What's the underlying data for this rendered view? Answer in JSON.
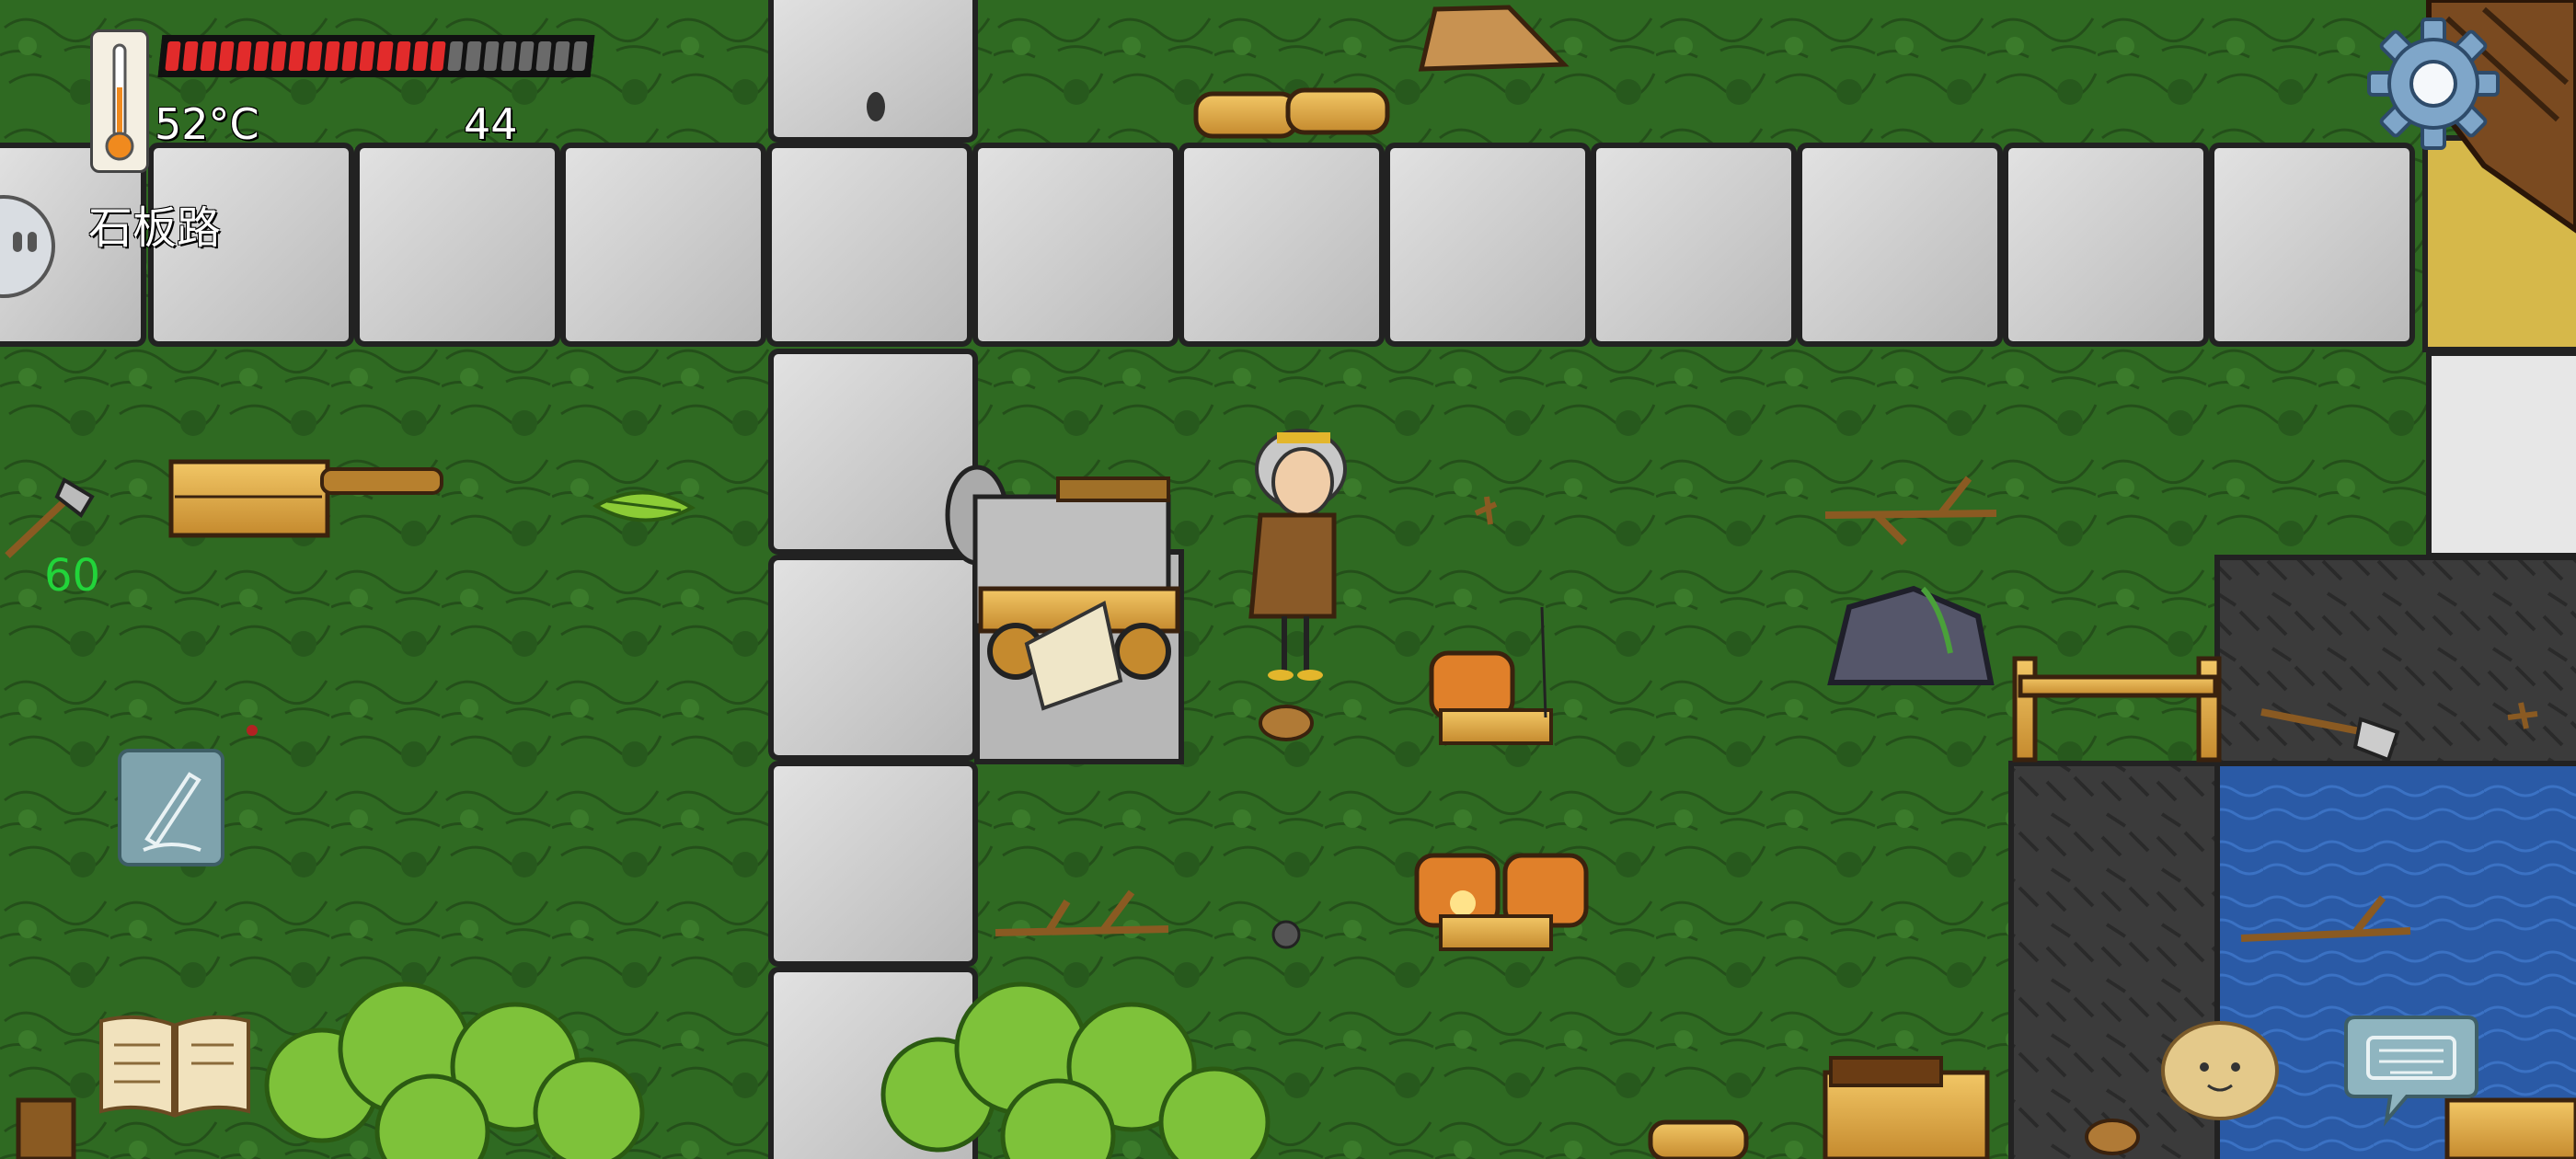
{
  "hud": {
    "temperature": "52°C",
    "yum_counter": "44",
    "tile_name": "石板路",
    "held_item_count": "60",
    "food_pips_filled": 16,
    "food_pips_total": 24
  },
  "colors": {
    "grass": "#2f6a22",
    "stone": "#c9c9c9",
    "water": "#2a5aa6",
    "dark_floor": "#3b3b3b",
    "food_red": "#e22b2b",
    "held_count_green": "#22d43a"
  },
  "icons": {
    "settings": "gear-icon",
    "thermometer": "thermometer-icon",
    "pencil": "pencil-icon",
    "book": "book-icon",
    "keyboard": "keyboard-icon",
    "emote": "emote-face-icon",
    "potato": "potato-emote-icon"
  }
}
